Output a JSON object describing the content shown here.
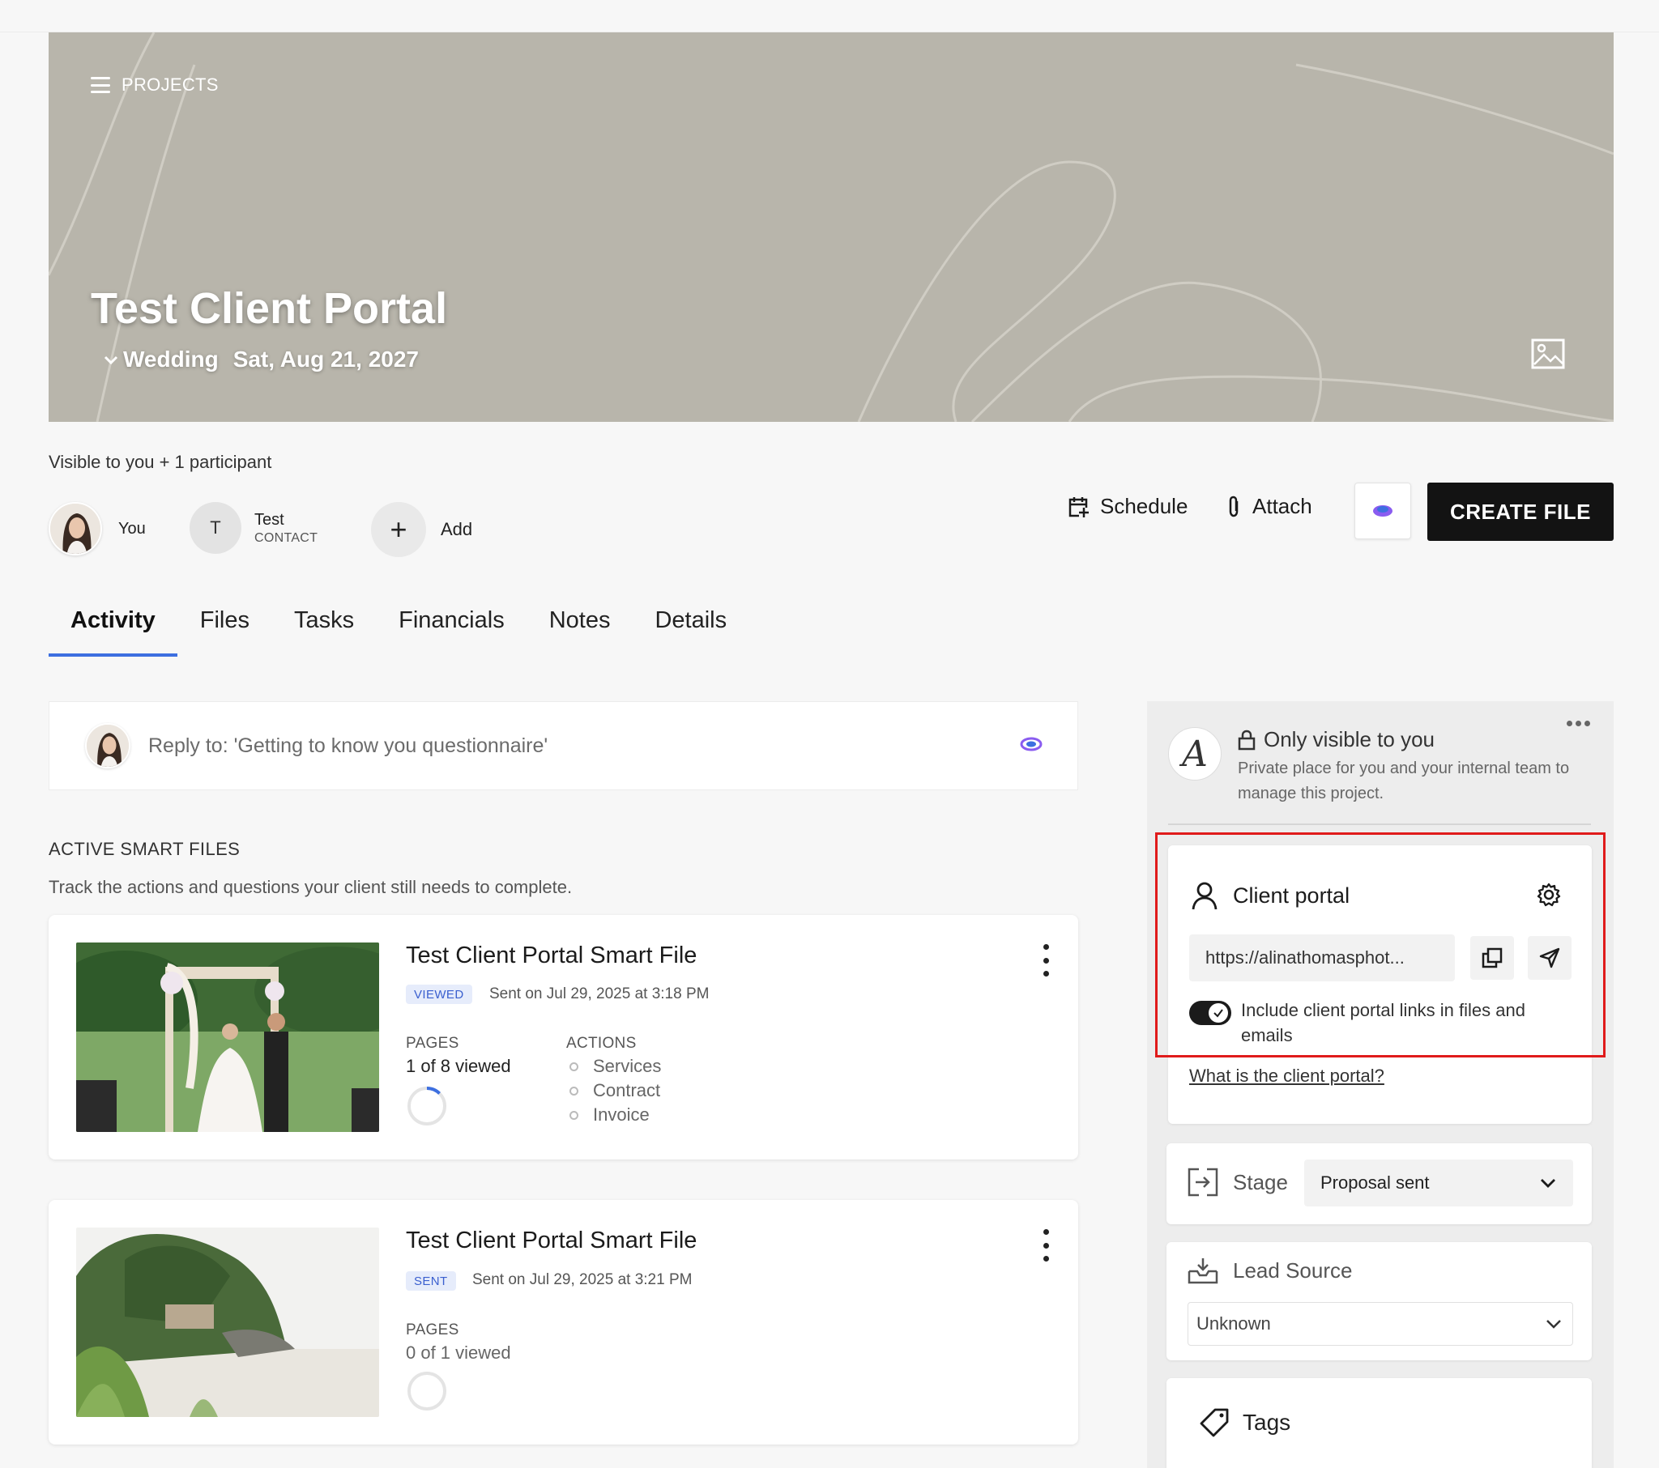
{
  "banner": {
    "nav_label": "PROJECTS",
    "title": "Test Client Portal",
    "project_type": "Wedding",
    "date": "Sat, Aug 21, 2027",
    "bg_color": "#b8b5ab"
  },
  "participants": {
    "visibility": "Visible to you + 1 participant",
    "you_label": "You",
    "contact_initial": "T",
    "contact_name": "Test",
    "contact_role": "CONTACT",
    "add_label": "Add"
  },
  "actions": {
    "schedule": "Schedule",
    "attach": "Attach",
    "create_file": "CREATE FILE"
  },
  "tabs": [
    {
      "label": "Activity",
      "active": true
    },
    {
      "label": "Files"
    },
    {
      "label": "Tasks"
    },
    {
      "label": "Financials"
    },
    {
      "label": "Notes"
    },
    {
      "label": "Details"
    }
  ],
  "reply": {
    "placeholder": "Reply to: 'Getting to know you questionnaire'"
  },
  "smart_files": {
    "heading": "ACTIVE SMART FILES",
    "subtitle": "Track the actions and questions your client still needs to complete.",
    "items": [
      {
        "title": "Test Client Portal Smart File",
        "badge": "VIEWED",
        "sent_on": "Sent on Jul 29, 2025 at 3:18 PM",
        "pages_label": "PAGES",
        "pages_value": "1 of 8 viewed",
        "pages_progress": 0.125,
        "actions_label": "ACTIONS",
        "actions": [
          "Services",
          "Contract",
          "Invoice"
        ]
      },
      {
        "title": "Test Client Portal Smart File",
        "badge": "SENT",
        "sent_on": "Sent on Jul 29, 2025 at 3:21 PM",
        "pages_label": "PAGES",
        "pages_value": "0 of 1 viewed",
        "pages_progress": 0
      }
    ]
  },
  "sidebar": {
    "internal_title": "Only visible to you",
    "internal_desc": "Private place for you and your internal team to manage this project.",
    "client_portal": {
      "title": "Client portal",
      "url": "https://alinathomasphot...",
      "toggle_label": "Include client portal links in files and emails",
      "toggle_on": true,
      "help_link": "What is the client portal?"
    },
    "stage": {
      "label": "Stage",
      "value": "Proposal sent"
    },
    "lead_source": {
      "label": "Lead Source",
      "value": "Unknown"
    },
    "tags": {
      "label": "Tags"
    }
  },
  "colors": {
    "accent": "#3d6fe0",
    "highlight": "#e01b1b",
    "primary_button": "#131313",
    "badge_bg": "#e6ecfb",
    "badge_text": "#3a5fcf"
  }
}
